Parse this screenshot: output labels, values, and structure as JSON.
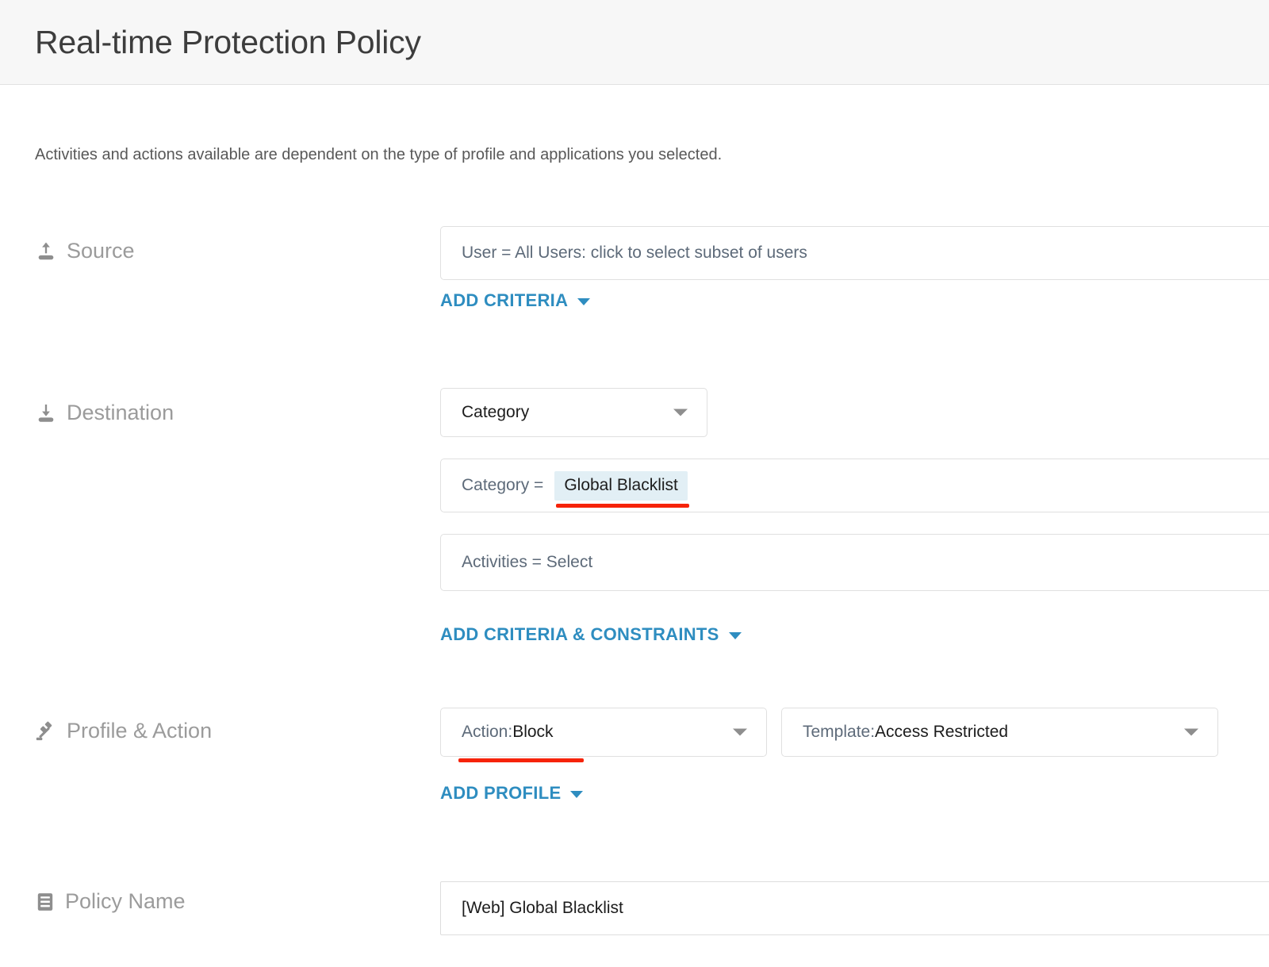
{
  "header": {
    "title": "Real-time Protection Policy"
  },
  "intro": {
    "text": "Activities and actions available are dependent on the type of profile and applications you selected."
  },
  "sections": {
    "source": {
      "label": "Source",
      "icon": "upload-icon",
      "field_value": "User = All Users: click to select subset of users",
      "add_link": "ADD CRITERIA"
    },
    "destination": {
      "label": "Destination",
      "icon": "download-icon",
      "type_dropdown": "Category",
      "criteria_label": "Category =",
      "criteria_value": "Global Blacklist",
      "activities_value": "Activities = Select",
      "add_link": "ADD CRITERIA & CONSTRAINTS"
    },
    "profile_action": {
      "label": "Profile & Action",
      "icon": "gavel-icon",
      "action_prefix": "Action: ",
      "action_value": "Block",
      "template_prefix": "Template: ",
      "template_value": "Access Restricted",
      "add_link": "ADD PROFILE"
    },
    "policy_name": {
      "label": "Policy Name",
      "icon": "document-list-icon",
      "value": "[Web] Global Blacklist"
    }
  },
  "colors": {
    "link_blue": "#2e8dc0",
    "annotation_red": "#f62309",
    "chip_bg": "#e2eff5",
    "header_bg": "#f7f7f7",
    "label_gray": "#9b9b9b"
  }
}
